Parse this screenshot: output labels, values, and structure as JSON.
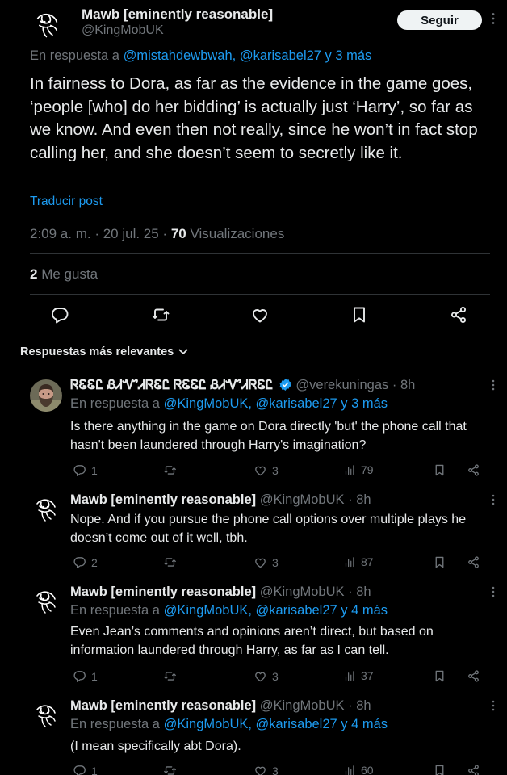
{
  "main_post": {
    "author_name": "Mawb [eminently reasonable]",
    "author_handle": "@KingMobUK",
    "follow_label": "Seguir",
    "reply_prefix": "En respuesta a",
    "reply_to": "@mistahdewbwah, @karisabel27 y 3 más",
    "text": "In fairness to Dora, as far as the evidence in the game goes, ‘people [who] do her bidding’ is actually just ‘Harry’, so far as we know. And even then not really, since he won’t in fact stop calling her, and she doesn’t seem to secretly like it.",
    "translate_label": "Traducir post",
    "timestamp": "2:09 a. m. · 20 jul. 25 · ",
    "views_count": "70",
    "views_label": " Visualizaciones",
    "likes_count": "2",
    "likes_label": " Me gusta"
  },
  "sort_label": "Respuestas más relevantes",
  "replies": [
    {
      "author_name": "ᏒᏋᏋᏝ ᏰᏗᏉᏗᏒᏋᏝ ᏒᏋᏋᏝ ᏰᏗᏉᏗᏒᏋᏝ",
      "verified": true,
      "handle_time": "@verekuningas · 8h",
      "reply_prefix": "En respuesta a",
      "reply_to": "@KingMobUK, @karisabel27 y 3 más",
      "text": "Is there anything in the game on Dora directly 'but' the phone call that hasn't been laundered through Harry's imagination?",
      "replies": "1",
      "likes": "3",
      "views": "79"
    },
    {
      "author_name": "Mawb [eminently reasonable]",
      "verified": false,
      "handle_time": "@KingMobUK · 8h",
      "text": "Nope. And if you pursue the phone call options over multiple plays he doesn’t come out of it well, tbh.",
      "replies": "2",
      "likes": "3",
      "views": "87"
    },
    {
      "author_name": "Mawb [eminently reasonable]",
      "verified": false,
      "handle_time": "@KingMobUK · 8h",
      "reply_prefix": "En respuesta a",
      "reply_to": "@KingMobUK, @karisabel27 y 4 más",
      "text": "Even Jean’s comments and opinions aren’t direct, but based on information laundered through Harry, as far as I can tell.",
      "replies": "1",
      "likes": "3",
      "views": "37"
    },
    {
      "author_name": "Mawb [eminently reasonable]",
      "verified": false,
      "handle_time": "@KingMobUK · 8h",
      "reply_prefix": "En respuesta a",
      "reply_to": "@KingMobUK, @karisabel27 y 4 más",
      "text": "(I mean specifically abt Dora).",
      "replies": "1",
      "likes": "3",
      "views": "60"
    }
  ],
  "icons": [
    "more-icon",
    "reply-icon",
    "retweet-icon",
    "like-icon",
    "bookmark-icon",
    "share-icon",
    "views-icon",
    "verified-icon",
    "chevron-down-icon"
  ],
  "colors": {
    "accent": "#1d9bf0",
    "muted": "#71767b",
    "text": "#e7e9ea",
    "background": "#000000",
    "divider": "#2f3336"
  }
}
